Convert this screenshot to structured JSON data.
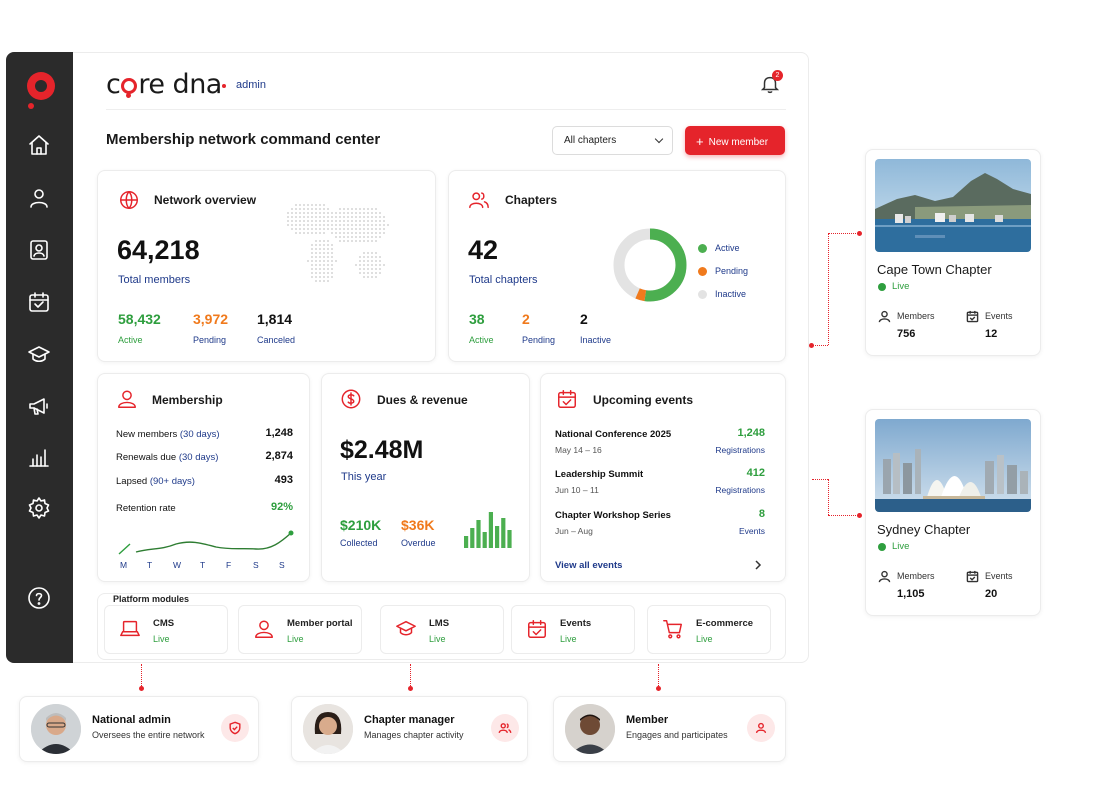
{
  "brand": {
    "name_pre": "c",
    "name_post": "re dna",
    "role": "admin"
  },
  "notifications": {
    "count": "2"
  },
  "page": {
    "title": "Membership network command center",
    "filter_value": "All chapters",
    "new_member_label": "New member",
    "new_member_icon": "plus-icon"
  },
  "sidebar": {
    "items": [
      "home-icon",
      "user-icon",
      "contact-card-icon",
      "calendar-icon",
      "graduation-cap-icon",
      "megaphone-icon",
      "bar-chart-icon",
      "gear-icon",
      "help-icon"
    ]
  },
  "network": {
    "title": "Network overview",
    "total": "64,218",
    "total_label": "Total members",
    "stats": [
      {
        "value": "58,432",
        "label": "Active",
        "color": "#2e9e3e"
      },
      {
        "value": "3,972",
        "label": "Pending",
        "color": "#f07a1d"
      },
      {
        "value": "1,814",
        "label": "Canceled",
        "color": "#111111"
      }
    ]
  },
  "chapters": {
    "title": "Chapters",
    "total": "42",
    "total_label": "Total chapters",
    "stats": [
      {
        "value": "38",
        "label": "Active"
      },
      {
        "value": "2",
        "label": "Pending"
      },
      {
        "value": "2",
        "label": "Inactive"
      }
    ],
    "legend": [
      "Active",
      "Pending",
      "Inactive"
    ],
    "colors": {
      "active": "#4caf50",
      "pending": "#f07a1d",
      "inactive": "#e3e3e3"
    }
  },
  "membership": {
    "title": "Membership",
    "rows": [
      {
        "label": "New members",
        "paren": "(30 days)",
        "value": "1,248"
      },
      {
        "label": "Renewals due",
        "paren": "(30 days)",
        "value": "2,874"
      },
      {
        "label": "Lapsed",
        "paren": "(90+ days)",
        "value": "493"
      }
    ],
    "retention_label": "Retention rate",
    "retention_value": "92%",
    "days": [
      "M",
      "T",
      "W",
      "T",
      "F",
      "S",
      "S"
    ]
  },
  "dues": {
    "title": "Dues & revenue",
    "amount": "$2.48M",
    "period": "This year",
    "collected_value": "$210K",
    "collected_label": "Collected",
    "overdue_value": "$36K",
    "overdue_label": "Overdue"
  },
  "events": {
    "title": "Upcoming events",
    "items": [
      {
        "name": "National Conference 2025",
        "date": "May 14 – 16",
        "count": "1,248",
        "unit": "Registrations"
      },
      {
        "name": "Leadership Summit",
        "date": "Jun 10 – 11",
        "count": "412",
        "unit": "Registrations"
      },
      {
        "name": "Chapter Workshop Series",
        "date": "Jun – Aug",
        "count": "8",
        "unit": "Events"
      }
    ],
    "view_all": "View all events"
  },
  "modules": {
    "title": "Platform modules",
    "items": [
      {
        "name": "CMS",
        "status": "Live",
        "icon": "laptop-icon"
      },
      {
        "name": "Member portal",
        "status": "Live",
        "icon": "user-icon"
      },
      {
        "name": "LMS",
        "status": "Live",
        "icon": "graduation-cap-icon"
      },
      {
        "name": "Events",
        "status": "Live",
        "icon": "calendar-check-icon"
      },
      {
        "name": "E-commerce",
        "status": "Live",
        "icon": "cart-icon"
      }
    ]
  },
  "chapter_cards": [
    {
      "name": "Cape Town Chapter",
      "status": "Live",
      "members_label": "Members",
      "members": "756",
      "events_label": "Events",
      "events": "12"
    },
    {
      "name": "Sydney Chapter",
      "status": "Live",
      "members_label": "Members",
      "members": "1,105",
      "events_label": "Events",
      "events": "20"
    }
  ],
  "personas": [
    {
      "role": "National admin",
      "desc": "Oversees the entire network",
      "icon": "shield-icon"
    },
    {
      "role": "Chapter manager",
      "desc": "Manages chapter activity",
      "icon": "users-icon"
    },
    {
      "role": "Member",
      "desc": "Engages and participates",
      "icon": "user-icon"
    }
  ]
}
